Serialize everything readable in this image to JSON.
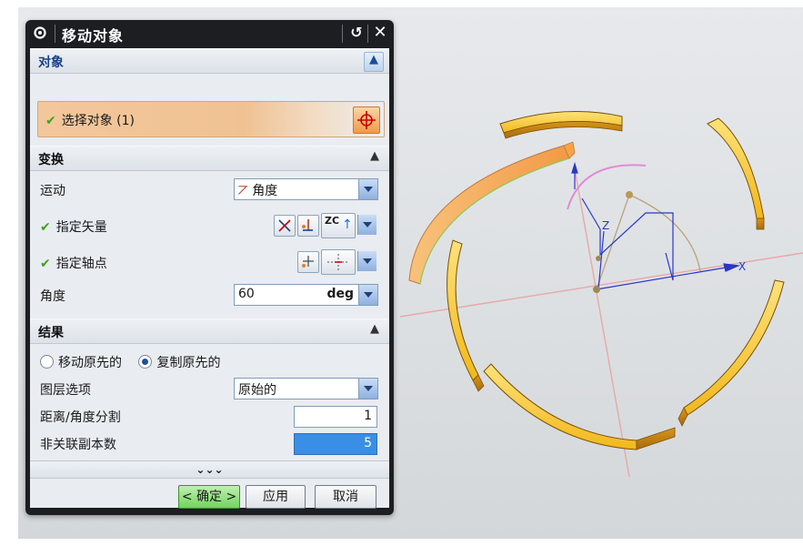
{
  "dialog": {
    "title": "移动对象",
    "sections": {
      "object": "对象",
      "transform": "变换",
      "result": "结果"
    },
    "select_object_label": "选择对象 (1)",
    "motion_label": "运动",
    "motion_value": "角度",
    "vector_label": "指定矢量",
    "vector_btn_text": "ZC",
    "pivot_label": "指定轴点",
    "angle_label": "角度",
    "angle_value": "60",
    "angle_unit": "deg",
    "move_original": "移动原先的",
    "copy_original": "复制原先的",
    "layer_option_label": "图层选项",
    "layer_option_value": "原始的",
    "distance_angle_label": "距离/角度分割",
    "distance_angle_value": "1",
    "copies_label": "非关联副本数",
    "copies_value": "5",
    "more_glyph": "⌄⌄⌄",
    "ok": "< 确定 >",
    "apply": "应用",
    "cancel": "取消"
  },
  "viewport": {
    "axis_x_label": "X",
    "axis_z_label": "Z"
  },
  "colors": {
    "part_fill": "#f2b81c",
    "part_highlight": "#f6a34a",
    "axis_line": "#e7a8a8",
    "dialog_frame": "#1c1e22"
  }
}
